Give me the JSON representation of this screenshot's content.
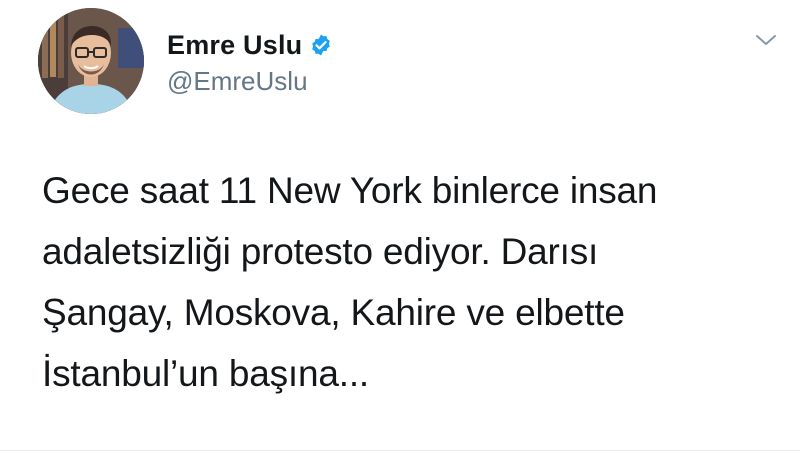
{
  "tweet": {
    "author": {
      "display_name": "Emre Uslu",
      "handle": "@EmreUslu",
      "verified": true,
      "avatar_icon": "profile-photo"
    },
    "menu_icon": "chevron-down-icon",
    "text_lines": [
      "Gece saat 11 New York binlerce insan",
      "adaletsizliği protesto ediyor. Darısı",
      "Şangay, Moskova, Kahire ve elbette",
      "İstanbul’un başına..."
    ]
  },
  "colors": {
    "verified_badge": "#1da1f2",
    "handle_text": "#657786",
    "body_text": "#14171a"
  }
}
